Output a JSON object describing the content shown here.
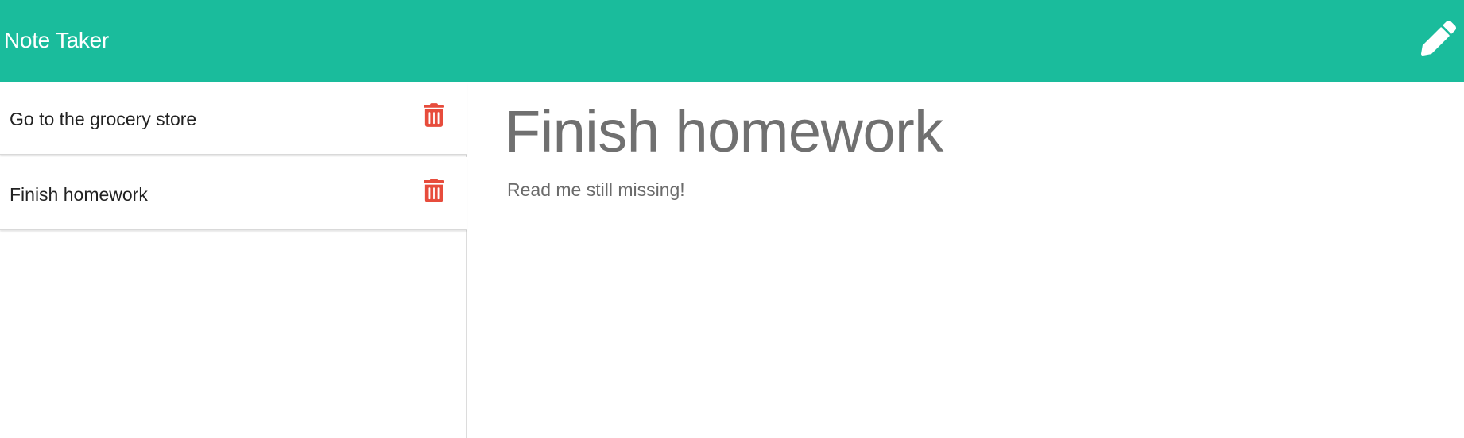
{
  "app": {
    "title": "Note Taker"
  },
  "header": {
    "new_note_icon": "pencil-icon",
    "text_color": "#ffffff",
    "background": "#1abc9c"
  },
  "sidebar": {
    "notes": [
      {
        "title": "Go to the grocery store",
        "delete_icon": "trash-icon"
      },
      {
        "title": "Finish homework",
        "delete_icon": "trash-icon"
      }
    ],
    "delete_color": "#e74c3c"
  },
  "main": {
    "note_title": "Finish homework",
    "note_text": "Read me still missing!"
  }
}
